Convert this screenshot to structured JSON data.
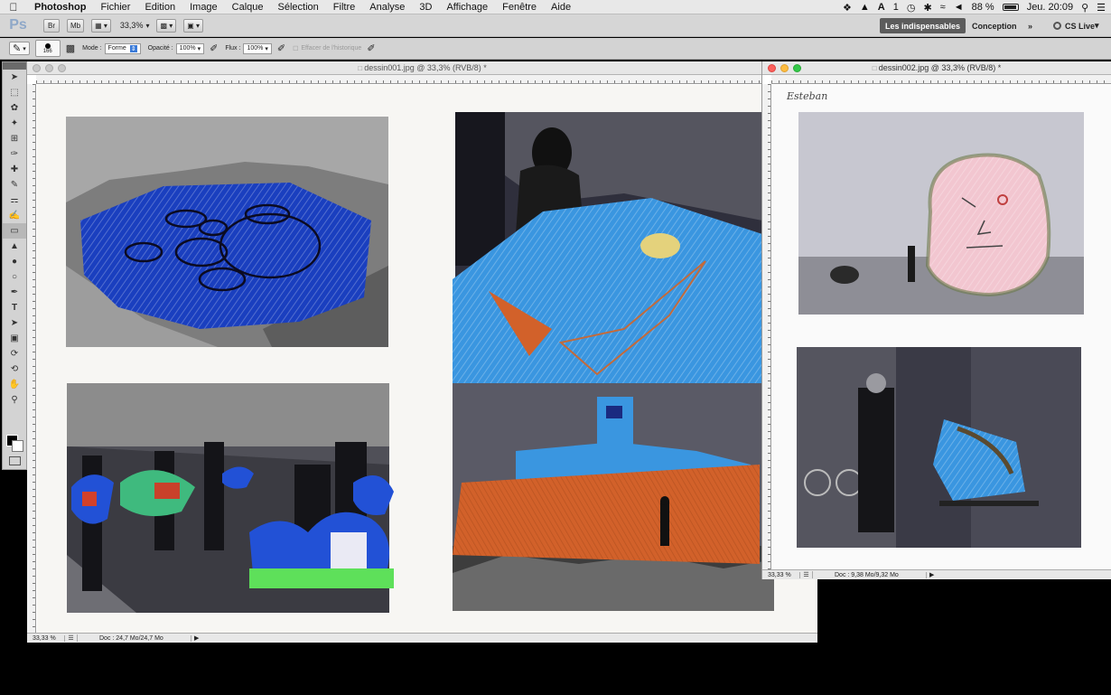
{
  "menubar": {
    "apple": "",
    "app_name": "Photoshop",
    "items": [
      "Fichier",
      "Edition",
      "Image",
      "Calque",
      "Sélection",
      "Filtre",
      "Analyse",
      "3D",
      "Affichage",
      "Fenêtre",
      "Aide"
    ],
    "status": {
      "adobe_label": "1",
      "battery": "88 %",
      "clock": "Jeu. 20:09"
    }
  },
  "appbar": {
    "logo": "Ps",
    "br_label": "Br",
    "mb_label": "Mb",
    "zoom": "33,3%",
    "workspaces": {
      "essentials": "Les indispensables",
      "design": "Conception",
      "more": "»",
      "cslive": "CS Live"
    }
  },
  "options": {
    "brush_size": "166",
    "mode_label": "Mode :",
    "mode_value": "Forme",
    "opacity_label": "Opacité :",
    "opacity_value": "100%",
    "flow_label": "Flux :",
    "flow_value": "100%",
    "erase_history_label": "Effacer de l'historique"
  },
  "doc1": {
    "title": "dessin001.jpg @ 33,3% (RVB/8) *",
    "zoom": "33,33 %",
    "doc_size": "Doc : 24,7 Mo/24,7 Mo"
  },
  "doc2": {
    "title": "dessin002.jpg @ 33,3% (RVB/8) *",
    "zoom": "33,33 %",
    "doc_size": "Doc : 9,38 Mo/9,32 Mo",
    "handwriting": "Esteban"
  },
  "colors": {
    "menubar_bg": "#e8e8e8",
    "workspace_active": "#5c5c5c",
    "traffic_red": "#fc605c",
    "traffic_yellow": "#fdbc40",
    "traffic_green": "#34c84a",
    "crayon_blue": "#3a96e0",
    "marker_blue": "#1a3fbf",
    "crayon_orange": "#d2612a"
  }
}
